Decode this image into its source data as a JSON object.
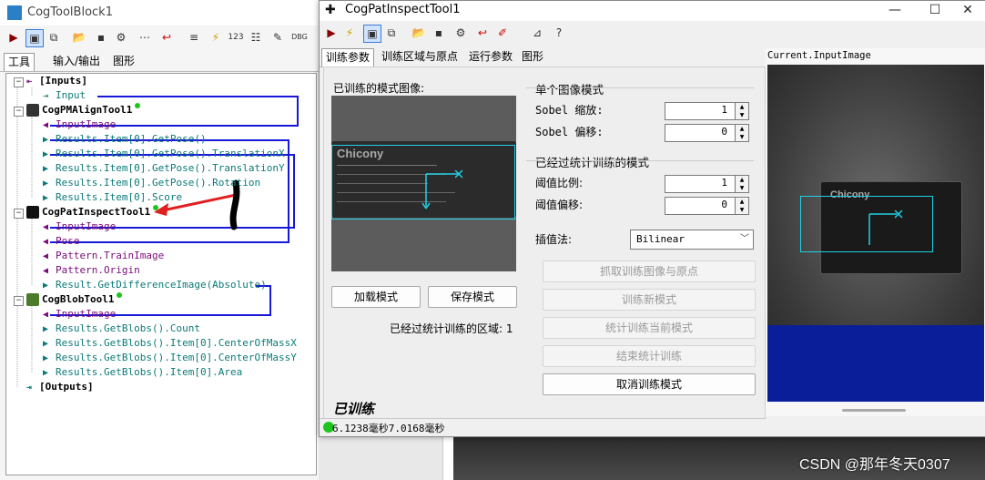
{
  "win1": {
    "title": "CogToolBlock1",
    "tabs": [
      "工具",
      "输入/输出",
      "图形"
    ],
    "tree": {
      "inputs_label": "[Inputs]",
      "input_item": "Input",
      "tool1": {
        "name": "CogPMAlignTool1",
        "items": [
          "InputImage",
          "Results.Item[0].GetPose()",
          "Results.Item[0].GetPose().TranslationX",
          "Results.Item[0].GetPose().TranslationY",
          "Results.Item[0].GetPose().Rotation",
          "Results.Item[0].Score"
        ]
      },
      "tool2": {
        "name": "CogPatInspectTool1",
        "items": [
          "InputImage",
          "Pose",
          "Pattern.TrainImage",
          "Pattern.Origin",
          "Result.GetDifferenceImage(Absolute)"
        ]
      },
      "tool3": {
        "name": "CogBlobTool1",
        "items": [
          "InputImage",
          "Results.GetBlobs().Count",
          "Results.GetBlobs().Item[0].CenterOfMassX",
          "Results.GetBlobs().Item[0].CenterOfMassY",
          "Results.GetBlobs().Item[0].Area"
        ]
      },
      "outputs_label": "[Outputs]"
    }
  },
  "win2": {
    "title": "CogPatInspectTool1",
    "tabs": [
      "训练参数",
      "训练区域与原点",
      "运行参数",
      "图形"
    ],
    "trained_pattern_label": "已训练的模式图像:",
    "single_image_group": "单个图像模式",
    "sobel_scale_label": "Sobel 缩放:",
    "sobel_scale_value": "1",
    "sobel_offset_label": "Sobel 偏移:",
    "sobel_offset_value": "0",
    "stat_group": "已经过统计训练的模式",
    "threshold_ratio_label": "阈值比例:",
    "threshold_ratio_value": "1",
    "threshold_offset_label": "阈值偏移:",
    "threshold_offset_value": "0",
    "interp_label": "插值法:",
    "interp_value": "Bilinear",
    "btn_grab": "抓取训练图像与原点",
    "btn_train_new": "训练新模式",
    "btn_stat_train": "统计训练当前模式",
    "btn_end_stat": "结束统计训练",
    "btn_cancel": "取消训练模式",
    "btn_load": "加载模式",
    "btn_save": "保存模式",
    "stat_regions_label": "已经过统计训练的区域: 1",
    "trained_status": "已训练",
    "status_times": "6.1238毫秒7.0168毫秒",
    "image_header": "Current.InputImage",
    "product_brand": "Chicony"
  },
  "watermark": "CSDN @那年冬天0307"
}
